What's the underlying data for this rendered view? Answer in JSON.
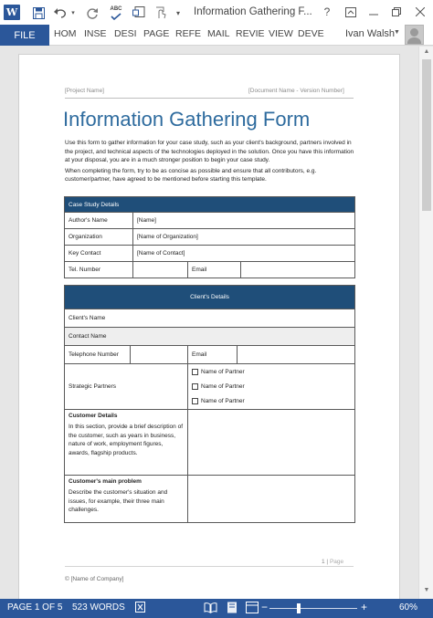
{
  "window": {
    "title": "Information Gathering F...",
    "app_icon_letter": "W",
    "help_glyph": "?"
  },
  "quick_access": {
    "icons": [
      "save-icon",
      "undo-icon",
      "redo-icon",
      "spelling-icon",
      "document-icon",
      "touch-mode-icon",
      "customize-icon"
    ],
    "spelling_label": "ABC"
  },
  "ribbon": {
    "file_tab": "FILE",
    "tabs": [
      "HOM",
      "INSE",
      "DESI",
      "PAGE",
      "REFE",
      "MAIL",
      "REVIE",
      "VIEW",
      "DEVE"
    ],
    "user": "Ivan Walsh"
  },
  "document": {
    "header_left": "[Project Name]",
    "header_right": "[Document Name - Version Number]",
    "title": "Information Gathering Form",
    "intro_1": "Use this form to gather information for your case study, such as your client's background, partners involved in the project, and technical aspects of the technologies deployed in the solution. Once you have this information at your disposal, you are in a much stronger position to begin your case study.",
    "intro_2": "When completing the form, try to be as concise as possible and ensure that all contributors, e.g. customer/partner, have agreed to be mentioned before starting this template.",
    "case_study": {
      "heading": "Case Study Details",
      "rows": [
        {
          "label": "Author's Name",
          "value": "[Name]"
        },
        {
          "label": "Organization",
          "value": "[Name of Organization]"
        },
        {
          "label": "Key Contact",
          "value": "[Name of Contact]"
        }
      ],
      "tel_label": "Tel. Number",
      "email_label": "Email"
    },
    "client": {
      "heading": "Client's Details",
      "name_label": "Client's Name",
      "contact_label": "Contact Name",
      "telephone_label": "Telephone Number",
      "email_label": "Email",
      "partners_label": "Strategic Partners",
      "partner_options": [
        "Name of Partner",
        "Name of Partner",
        "Name of Partner"
      ],
      "customer_heading": "Customer Details",
      "customer_desc": "In this section, provide a brief description of the customer, such as years in business, nature of work, employment figures, awards, flagship products.",
      "problem_heading": "Customer's main problem",
      "problem_desc": "Describe the customer's situation and issues, for example, their three main challenges."
    },
    "page_number": "1",
    "page_word": "Page",
    "footer_left": "© [Name of Company]"
  },
  "statusbar": {
    "page_info": "PAGE 1 OF 5",
    "words": "523 WORDS",
    "zoom": "60%",
    "zoom_value": 60,
    "minus": "−",
    "plus": "+"
  },
  "colors": {
    "word_blue": "#2b579a",
    "title_blue": "#2e6b9e",
    "table_header": "#1f4e79"
  }
}
